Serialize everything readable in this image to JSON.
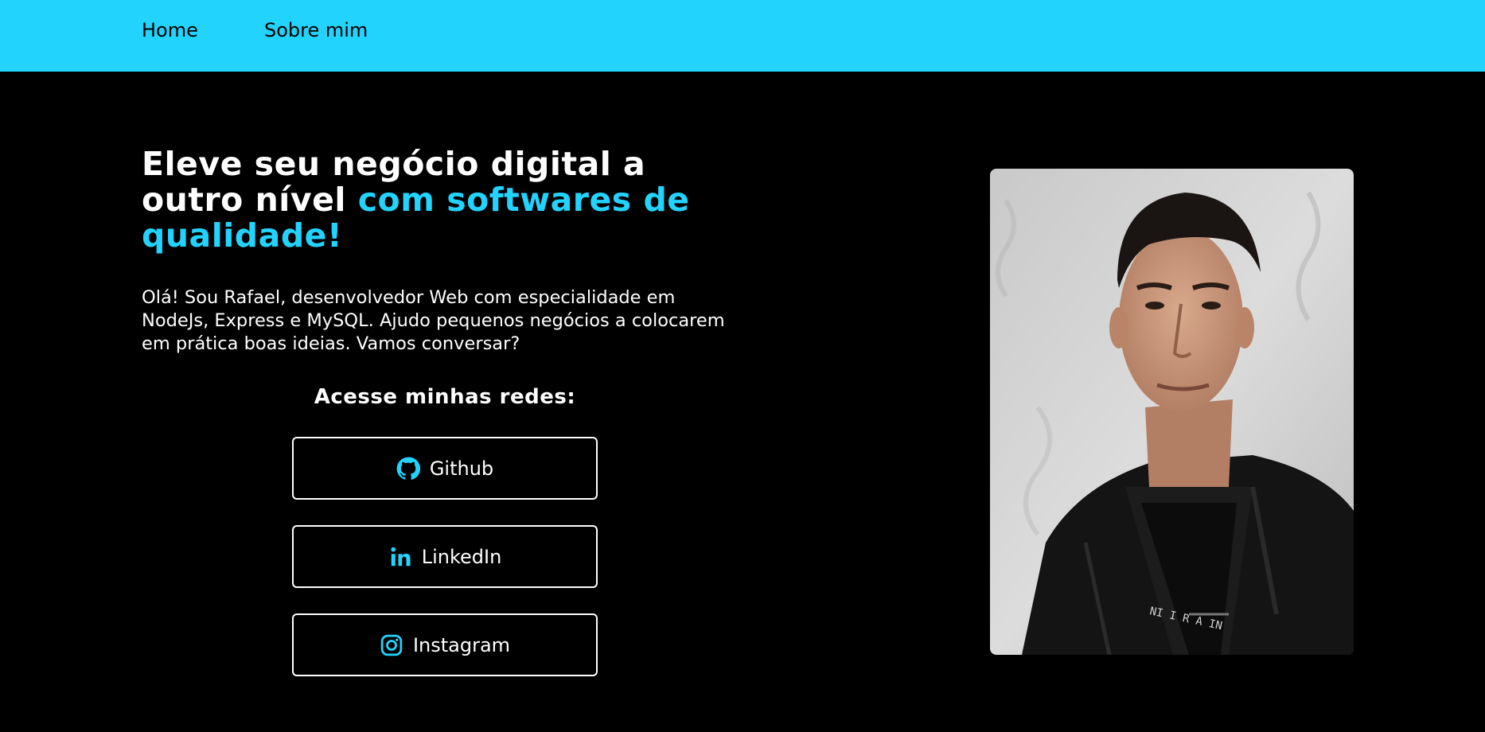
{
  "nav": {
    "home": "Home",
    "about": "Sobre mim"
  },
  "hero": {
    "headline_plain": "Eleve seu negócio digital a outro nível ",
    "headline_accent": "com softwares de qualidade!",
    "intro": "Olá! Sou Rafael, desenvolvedor Web com especialidade em NodeJs, Express e MySQL. Ajudo pequenos negócios a colocarem em prática boas ideias. Vamos conversar?"
  },
  "social": {
    "title": "Acesse minhas redes:",
    "buttons": [
      {
        "label": "Github",
        "icon": "github-icon"
      },
      {
        "label": "LinkedIn",
        "icon": "linkedin-icon"
      },
      {
        "label": "Instagram",
        "icon": "instagram-icon"
      }
    ]
  },
  "colors": {
    "accent": "#22d3fe",
    "background": "#000000",
    "text": "#ffffff"
  }
}
